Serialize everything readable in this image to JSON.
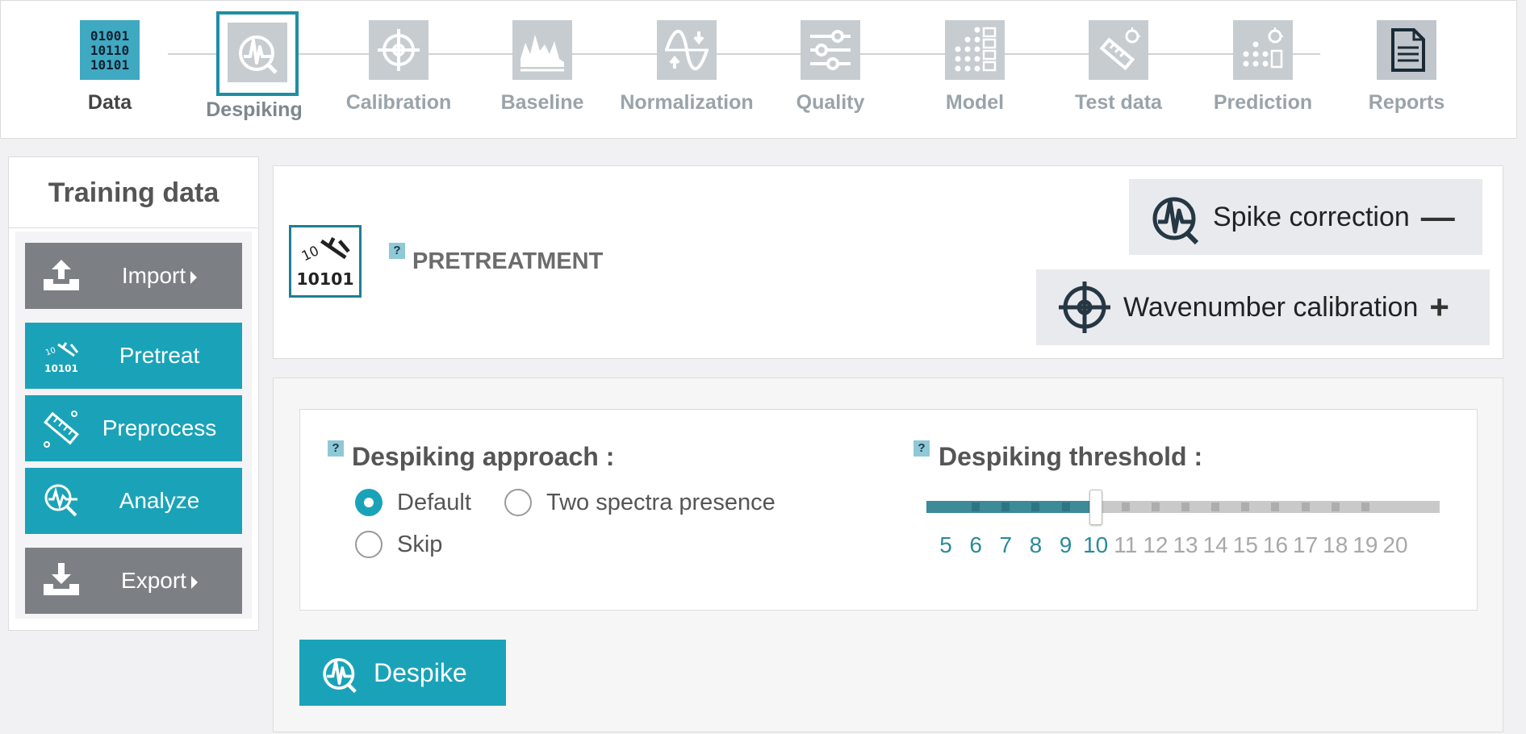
{
  "workflow": {
    "steps": [
      {
        "label": "Data",
        "icon": "binary-data-icon",
        "state": "done"
      },
      {
        "label": "Despiking",
        "icon": "despiking-icon",
        "state": "active"
      },
      {
        "label": "Calibration",
        "icon": "crosshair-icon",
        "state": "inactive"
      },
      {
        "label": "Baseline",
        "icon": "baseline-spectrum-icon",
        "state": "inactive"
      },
      {
        "label": "Normalization",
        "icon": "normalization-wave-icon",
        "state": "inactive"
      },
      {
        "label": "Quality",
        "icon": "sliders-icon",
        "state": "inactive"
      },
      {
        "label": "Model",
        "icon": "dot-grid-model-icon",
        "state": "inactive"
      },
      {
        "label": "Test data",
        "icon": "test-data-icon",
        "state": "inactive"
      },
      {
        "label": "Prediction",
        "icon": "prediction-bulb-icon",
        "state": "inactive"
      },
      {
        "label": "Reports",
        "icon": "document-icon",
        "state": "inactive"
      }
    ]
  },
  "sidebar": {
    "title": "Training data",
    "buttons": [
      {
        "label": "Import",
        "icon": "upload-icon",
        "style": "gray",
        "has_caret": true
      },
      {
        "label": "Pretreat",
        "icon": "pretreat-hammer-icon",
        "style": "teal",
        "has_caret": false
      },
      {
        "label": "Preprocess",
        "icon": "preprocess-ruler-icon",
        "style": "teal",
        "has_caret": false
      },
      {
        "label": "Analyze",
        "icon": "analyze-magnifier-icon",
        "style": "teal",
        "has_caret": false
      },
      {
        "label": "Export",
        "icon": "download-icon",
        "style": "gray",
        "has_caret": true
      }
    ]
  },
  "pretreatment": {
    "icon_text": "10101",
    "help_label": "?",
    "title": "PRETREATMENT",
    "methods": [
      {
        "label": "Spike correction",
        "toggle": "—",
        "state": "expanded"
      },
      {
        "label": "Wavenumber calibration",
        "toggle": "+",
        "state": "collapsed"
      }
    ]
  },
  "options": {
    "approach": {
      "help_label": "?",
      "heading": "Despiking approach :",
      "options": [
        {
          "label": "Default",
          "checked": true
        },
        {
          "label": "Two spectra presence",
          "checked": false
        },
        {
          "label": "Skip",
          "checked": false
        }
      ]
    },
    "threshold": {
      "help_label": "?",
      "heading": "Despiking threshold :",
      "min": 5,
      "max": 20,
      "value": 10,
      "ticks": [
        "5",
        "6",
        "7",
        "8",
        "9",
        "10",
        "11",
        "12",
        "13",
        "14",
        "15",
        "16",
        "17",
        "18",
        "19",
        "20"
      ]
    },
    "action_label": "Despike"
  },
  "colors": {
    "accent_teal": "#1aa3b8",
    "dark_teal": "#1e8fa3",
    "inactive_tile": "#c7ccd0",
    "gray_button": "#7c8084"
  }
}
